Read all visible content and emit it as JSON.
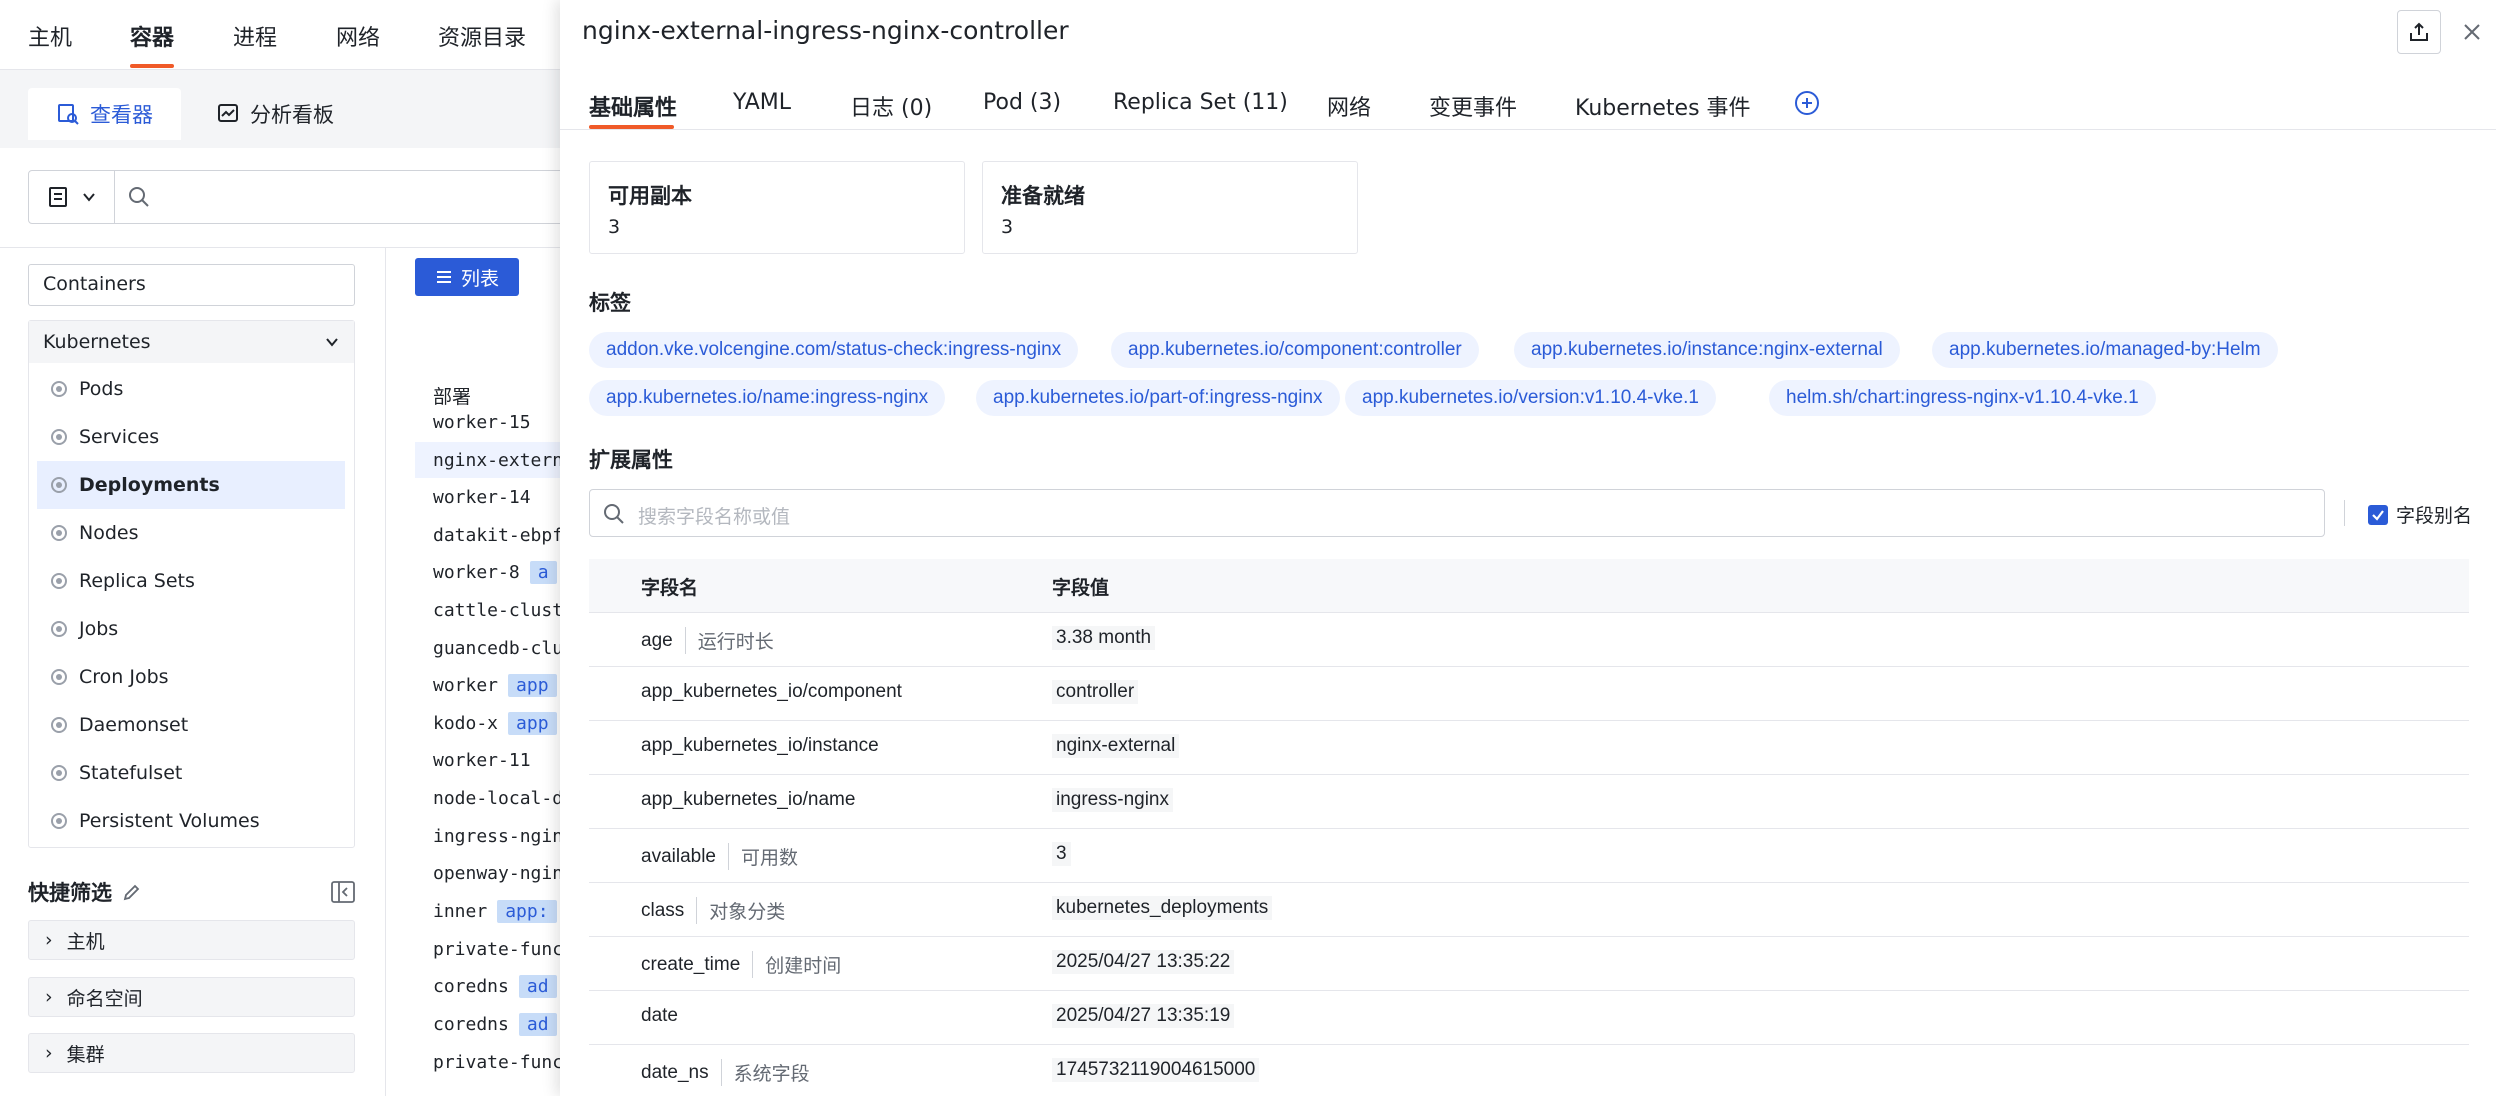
{
  "topnav": {
    "items": [
      "主机",
      "容器",
      "进程",
      "网络",
      "资源目录"
    ],
    "active": "容器"
  },
  "view_tabs": [
    {
      "label": "查看器",
      "icon": "viewer-icon",
      "active": true
    },
    {
      "label": "分析看板",
      "icon": "dashboard-icon",
      "active": false
    }
  ],
  "sidebar": {
    "filter_value": "Containers",
    "group_title": "Kubernetes",
    "items": [
      "Pods",
      "Services",
      "Deployments",
      "Nodes",
      "Replica Sets",
      "Jobs",
      "Cron Jobs",
      "Daemonset",
      "Statefulset",
      "Persistent Volumes"
    ],
    "active_item": "Deployments",
    "quick_filter_title": "快捷筛选",
    "quick_filters": [
      "主机",
      "命名空间",
      "集群"
    ]
  },
  "list": {
    "list_button": "列表",
    "column_header": "部署",
    "rows": [
      {
        "name": "worker-15",
        "chip": ""
      },
      {
        "name": "nginx-extern",
        "chip": ""
      },
      {
        "name": "worker-14",
        "chip": ""
      },
      {
        "name": "datakit-ebpf",
        "chip": ""
      },
      {
        "name": "worker-8",
        "chip": "a"
      },
      {
        "name": "cattle-clust",
        "chip": ""
      },
      {
        "name": "guancedb-clu",
        "chip": ""
      },
      {
        "name": "worker",
        "chip": "app"
      },
      {
        "name": "kodo-x",
        "chip": "app"
      },
      {
        "name": "worker-11",
        "chip": ""
      },
      {
        "name": "node-local-d",
        "chip": ""
      },
      {
        "name": "ingress-ngin",
        "chip": ""
      },
      {
        "name": "openway-ngin",
        "chip": ""
      },
      {
        "name": "inner",
        "chip": "app:"
      },
      {
        "name": "private-func",
        "chip": ""
      },
      {
        "name": "coredns",
        "chip": "ad"
      },
      {
        "name": "coredns",
        "chip": "ad"
      },
      {
        "name": "private-func",
        "chip": ""
      }
    ]
  },
  "drawer": {
    "title": "nginx-external-ingress-nginx-controller",
    "tabs": [
      "基础属性",
      "YAML",
      "日志 (0)",
      "Pod (3)",
      "Replica Set (11)",
      "网络",
      "变更事件",
      "Kubernetes 事件"
    ],
    "active_tab": "基础属性",
    "cards": [
      {
        "label": "可用副本",
        "value": "3"
      },
      {
        "label": "准备就绪",
        "value": "3"
      }
    ],
    "labels_title": "标签",
    "labels": [
      "addon.vke.volcengine.com/status-check:ingress-nginx",
      "app.kubernetes.io/component:controller",
      "app.kubernetes.io/instance:nginx-external",
      "app.kubernetes.io/managed-by:Helm",
      "app.kubernetes.io/name:ingress-nginx",
      "app.kubernetes.io/part-of:ingress-nginx",
      "app.kubernetes.io/version:v1.10.4-vke.1",
      "helm.sh/chart:ingress-nginx-v1.10.4-vke.1"
    ],
    "ext_title": "扩展属性",
    "search_placeholder": "搜索字段名称或值",
    "alias_toggle": "字段别名",
    "table": {
      "col_name": "字段名",
      "col_value": "字段值",
      "rows": [
        {
          "name": "age",
          "alias": "运行时长",
          "value": "3.38 month"
        },
        {
          "name": "app_kubernetes_io/component",
          "alias": "",
          "value": "controller"
        },
        {
          "name": "app_kubernetes_io/instance",
          "alias": "",
          "value": "nginx-external"
        },
        {
          "name": "app_kubernetes_io/name",
          "alias": "",
          "value": "ingress-nginx"
        },
        {
          "name": "available",
          "alias": "可用数",
          "value": "3"
        },
        {
          "name": "class",
          "alias": "对象分类",
          "value": "kubernetes_deployments"
        },
        {
          "name": "create_time",
          "alias": "创建时间",
          "value": "2025/04/27 13:35:22"
        },
        {
          "name": "date",
          "alias": "",
          "value": "2025/04/27 13:35:19"
        },
        {
          "name": "date_ns",
          "alias": "系统字段",
          "value": "1745732119004615000"
        }
      ]
    }
  },
  "colors": {
    "accent": "#2b5bd7",
    "tab_underline": "#f05a28",
    "tag_bg": "#eef3ff"
  }
}
